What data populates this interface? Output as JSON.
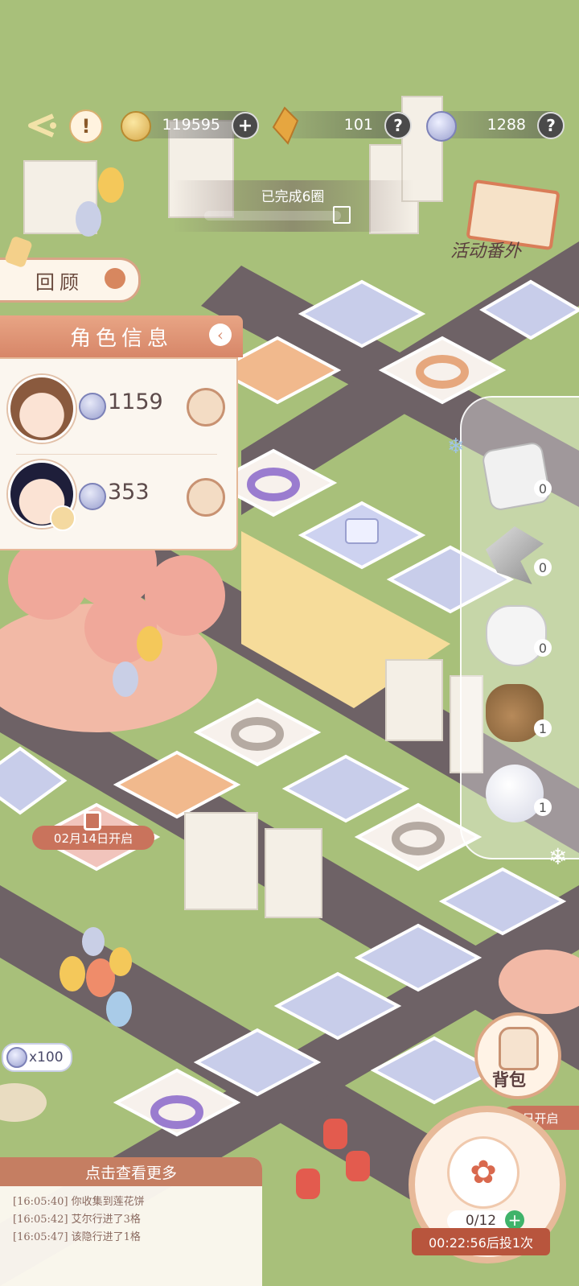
{
  "top_bar": {
    "coins": "119595",
    "crystals": "101",
    "tokens": "1288"
  },
  "progress": {
    "laps_completed": "已完成6圈"
  },
  "buttons": {
    "review": "回顾",
    "event_extra": "活动番外",
    "bag": "背包"
  },
  "char_panel": {
    "title": "角色信息",
    "characters": [
      {
        "value": "1159"
      },
      {
        "value": "353"
      }
    ]
  },
  "board": {
    "locked_tile_text": "02月14日开启",
    "locked_tile_text_right": "日开启",
    "reward_badge": "x100"
  },
  "items": [
    {
      "icon": "dice-icon",
      "count": "0"
    },
    {
      "icon": "arrow-icon",
      "count": "0"
    },
    {
      "icon": "glove-icon",
      "count": "0"
    },
    {
      "icon": "sack-icon",
      "count": "1"
    },
    {
      "icon": "snowball-icon",
      "count": "1"
    }
  ],
  "log": {
    "header": "点击查看更多",
    "lines": [
      "[16:05:40] 你收集到莲花饼",
      "[16:05:42] 艾尔行进了3格",
      "[16:05:47] 该隐行进了1格"
    ]
  },
  "roll": {
    "count": "0/12",
    "timer": "00:22:56后投1次"
  },
  "colors": {
    "ground": "#a8c07a",
    "road": "#6e6266",
    "tile_blue": "#c8cdea",
    "tile_orange": "#f1b98d",
    "accent": "#d78668"
  }
}
